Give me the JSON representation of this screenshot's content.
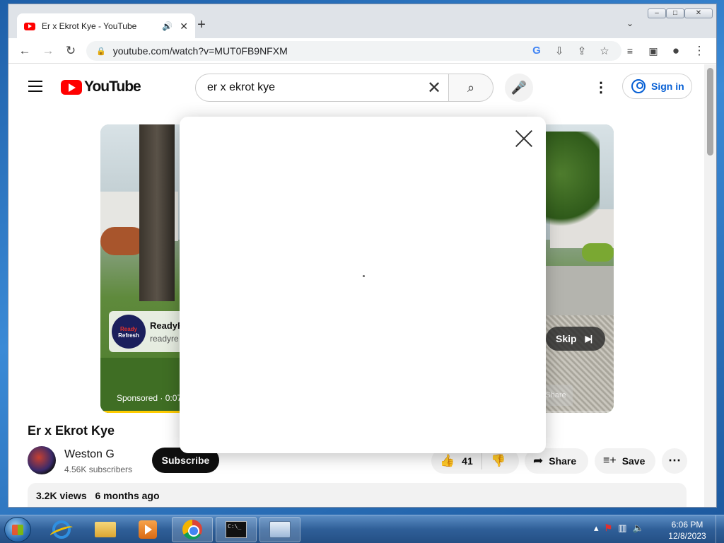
{
  "browser": {
    "tab_title": "Er x Ekrot Kye - YouTube",
    "url": "youtube.com/watch?v=MUT0FB9NFXM"
  },
  "header": {
    "logo_text": "YouTube",
    "search_query": "er x ekrot kye",
    "sign_in": "Sign in"
  },
  "player": {
    "ad_name": "ReadyR",
    "ad_site": "readyre",
    "ad_logo_line1": "Ready",
    "ad_logo_line2": "Refresh",
    "sponsored": "Sponsored · 0:07",
    "skip_label": "Skip",
    "share_ghost": "Share",
    "progress_fraction": 0.17
  },
  "video": {
    "title": "Er x Ekrot Kye",
    "channel": "Weston G",
    "subscribers": "4.56K subscribers",
    "subscribe": "Subscribe",
    "likes": "41",
    "share": "Share",
    "save": "Save",
    "views": "3.2K views",
    "age": "6 months ago"
  },
  "taskbar": {
    "time": "6:06 PM",
    "date": "12/8/2023",
    "cmd_prompt": "C:\\_"
  },
  "colors": {
    "youtube_red": "#ff0000",
    "signin_blue": "#065fd4",
    "progress_yellow": "#ffcc00"
  }
}
